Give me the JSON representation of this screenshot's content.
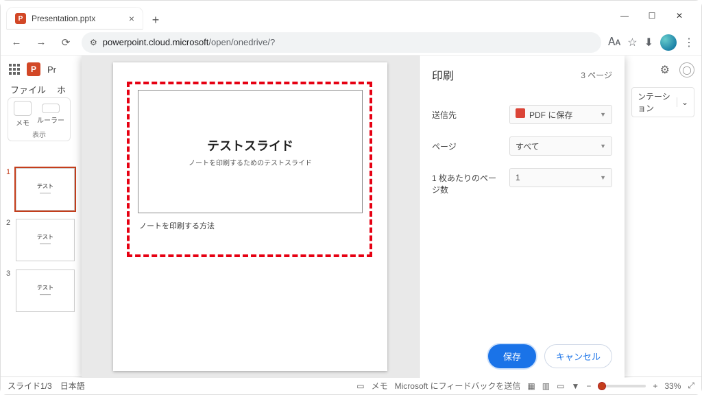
{
  "browser": {
    "tab_title": "Presentation.pptx",
    "url_host": "powerpoint.cloud.microsoft",
    "url_path": "/open/onedrive/?"
  },
  "app": {
    "title": "P",
    "title_full_prefix": "Pr",
    "menu": {
      "file": "ファイル",
      "home_prefix": "ホ"
    },
    "ribbon_group": {
      "memo": "メモ",
      "ruler": "ルーラー",
      "caption": "表示"
    },
    "presentation_button_suffix": "ンテーション",
    "dropdown_chevron": "⌄"
  },
  "thumbnails": [
    {
      "num": "1",
      "title": "テスト",
      "sub": "――",
      "selected": true
    },
    {
      "num": "2",
      "title": "テスト",
      "sub": "――",
      "selected": false
    },
    {
      "num": "3",
      "title": "テスト",
      "sub": "――",
      "selected": false
    }
  ],
  "preview": {
    "slide_title": "テストスライド",
    "slide_subtitle": "ノートを印刷するためのテストスライド",
    "note_text": "ノートを印刷する方法"
  },
  "print": {
    "title": "印刷",
    "page_count": "3 ページ",
    "labels": {
      "destination": "送信先",
      "pages": "ページ",
      "per_sheet": "1 枚あたりのページ数"
    },
    "destination_value": "PDF に保存",
    "pages_value": "すべて",
    "per_sheet_value": "1",
    "save": "保存",
    "cancel": "キャンセル"
  },
  "status": {
    "slide_counter": "スライド1/3",
    "language": "日本語",
    "memo": "メモ",
    "feedback": "Microsoft にフィードバックを送信",
    "zoom_pct": "33%"
  }
}
